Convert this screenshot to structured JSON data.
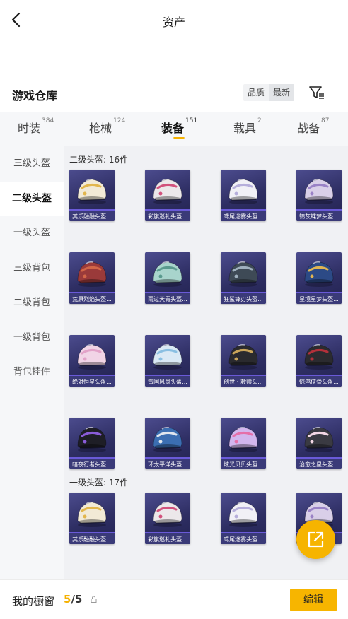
{
  "header": {
    "title": "资产",
    "back_icon": "chevron-left-icon"
  },
  "warehouse": {
    "title": "游戏仓库",
    "sort_options": [
      "品质",
      "最新"
    ],
    "active_sort": "最新",
    "filter_icon": "filter-icon"
  },
  "tabs": [
    {
      "label": "时装",
      "count": "384"
    },
    {
      "label": "枪械",
      "count": "124"
    },
    {
      "label": "装备",
      "count": "151",
      "active": true
    },
    {
      "label": "载具",
      "count": "2"
    },
    {
      "label": "战备",
      "count": "87"
    }
  ],
  "sidebar": {
    "items": [
      "三级头盔",
      "二级头盔",
      "一级头盔",
      "三级背包",
      "二级背包",
      "一级背包",
      "背包挂件"
    ],
    "active_index": 1
  },
  "groups": [
    {
      "title": "二级头盔: 16件",
      "items": [
        {
          "name": "其乐融融头盔...",
          "color": "#f2ead6",
          "accent": "#e2b64c"
        },
        {
          "name": "彩旗巡礼头盔...",
          "color": "#ece8ea",
          "accent": "#d2527c"
        },
        {
          "name": "鸢尾迷雾头盔...",
          "color": "#f1f0f6",
          "accent": "#b6aedb"
        },
        {
          "name": "锦灰蝶梦头盔...",
          "color": "#d9cfe8",
          "accent": "#9a82c6"
        },
        {
          "name": "荒原烈焰头盔...",
          "color": "#9a3a3a",
          "accent": "#d26648"
        },
        {
          "name": "雨过天青头盔...",
          "color": "#a8d4cc",
          "accent": "#5a9a8e"
        },
        {
          "name": "狂鲨锋刃头盔...",
          "color": "#3e4a56",
          "accent": "#9fb0be"
        },
        {
          "name": "星境星梦头盔...",
          "color": "#2c4a86",
          "accent": "#e0b552"
        },
        {
          "name": "绝对恒星头盔...",
          "color": "#f1d4e6",
          "accent": "#e2a2c8"
        },
        {
          "name": "雪国风尚头盔...",
          "color": "#dae9f5",
          "accent": "#8abfe2"
        },
        {
          "name": "创世・救赎头...",
          "color": "#2a2a2e",
          "accent": "#c9a45a"
        },
        {
          "name": "惊鸿侠骨头盔...",
          "color": "#2b2b2f",
          "accent": "#b2303a"
        },
        {
          "name": "暗夜行者头盔...",
          "color": "#1e1e26",
          "accent": "#8a5cd8"
        },
        {
          "name": "环太平洋头盔...",
          "color": "#3b6eb2",
          "accent": "#e0e6ee"
        },
        {
          "name": "炫光贝贝头盔...",
          "color": "#d2b6ee",
          "accent": "#e56fa9"
        },
        {
          "name": "治愈之星头盔...",
          "color": "#3a3a42",
          "accent": "#f2d6e4"
        }
      ]
    },
    {
      "title": "一级头盔: 17件",
      "items": [
        {
          "name": "其乐融融头盔...",
          "color": "#f2ead6",
          "accent": "#e2b64c"
        },
        {
          "name": "彩旗巡礼头盔...",
          "color": "#ece8ea",
          "accent": "#d2527c"
        },
        {
          "name": "鸢尾迷雾头盔...",
          "color": "#f1f0f6",
          "accent": "#b6aedb"
        },
        {
          "name": "锦灰蝶梦头盔...",
          "color": "#d9cfe8",
          "accent": "#9a82c6"
        }
      ]
    }
  ],
  "fab_icon": "external-link-icon",
  "footer": {
    "label": "我的橱窗",
    "used": "5",
    "separator": "/",
    "total": "5",
    "lock_icon": "lock-icon",
    "edit_label": "编辑"
  },
  "colors": {
    "accent": "#f5b100",
    "card_bg": "#2e2e63",
    "card_label_bar": "#3a3a78"
  }
}
